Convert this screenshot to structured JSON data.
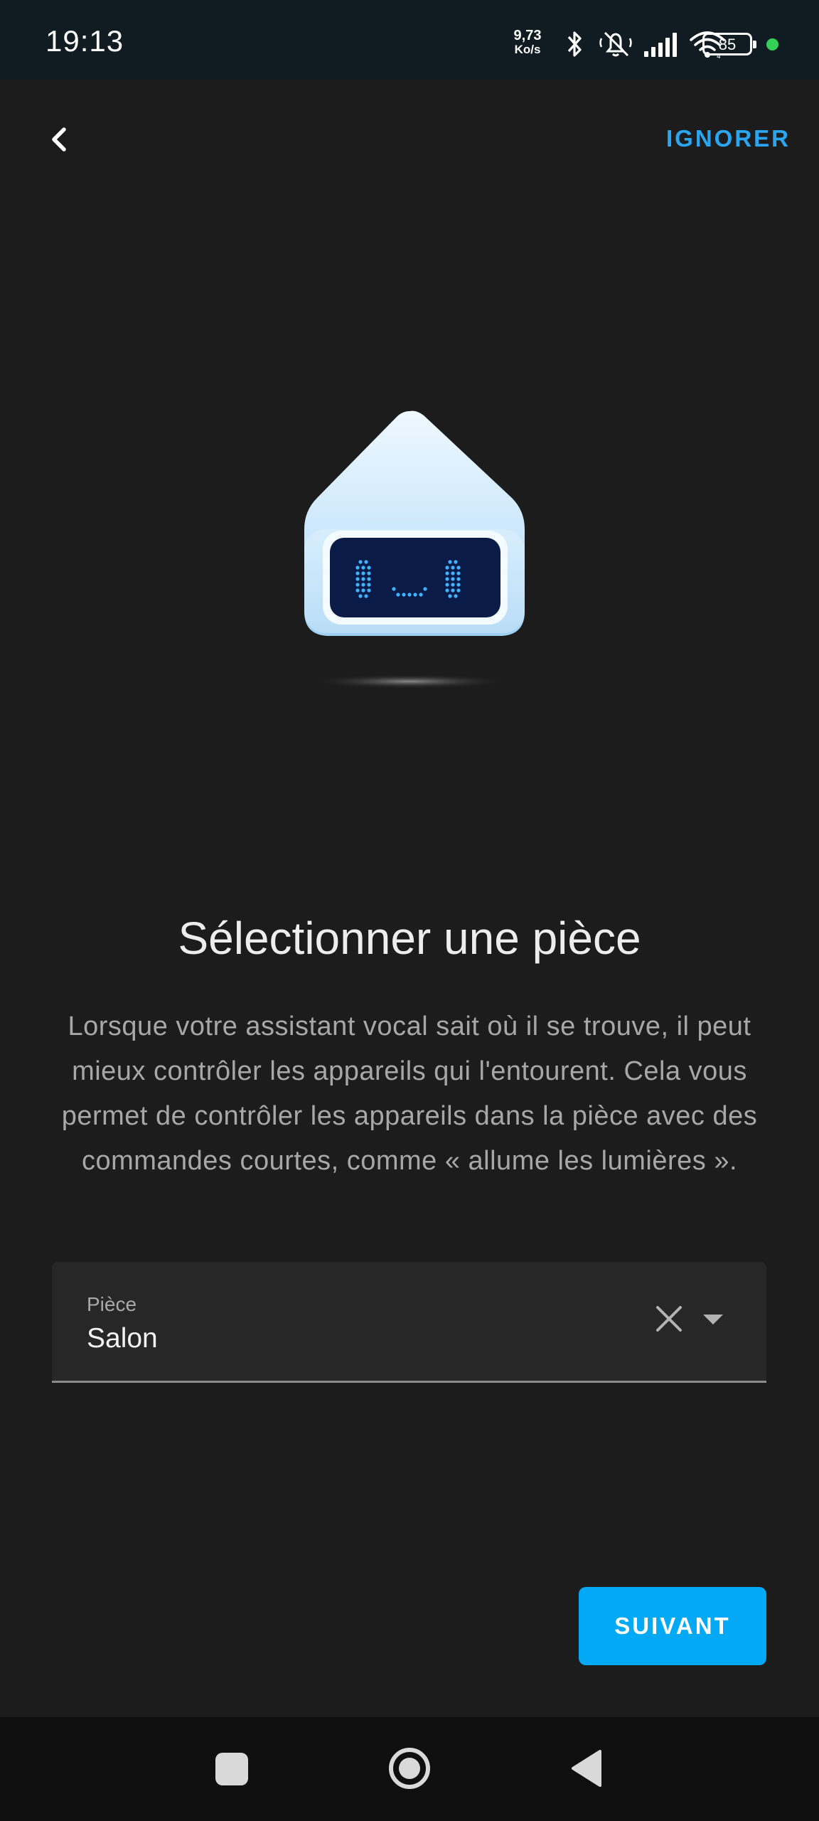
{
  "status_bar": {
    "time": "19:13",
    "net_speed_value": "9,73",
    "net_speed_unit": "Ko/s",
    "battery_level": "85",
    "icons": [
      "bluetooth-icon",
      "muted-bell-icon",
      "signal-icon",
      "wifi-icon",
      "battery-icon",
      "privacy-dot-icon"
    ]
  },
  "header": {
    "back_icon": "chevron-left-icon",
    "skip_label": "IGNORER"
  },
  "illustration": {
    "name": "voice-assistant-robot-illustration"
  },
  "content": {
    "title": "Sélectionner une pièce",
    "description": "Lorsque votre assistant vocal sait où il se trouve, il peut mieux contrôler les appareils qui l'entourent. Cela vous permet de contrôler les appareils dans la pièce avec des commandes courtes, comme « allume les lumières »."
  },
  "room_select": {
    "label": "Pièce",
    "value": "Salon",
    "clear_icon": "close-icon",
    "dropdown_icon": "caret-down-icon"
  },
  "footer": {
    "next_label": "SUIVANT"
  },
  "colors": {
    "accent": "#03a9f4",
    "skip_text": "#2aa6f1",
    "background": "#1c1c1c"
  },
  "nav_bar": {
    "icons": [
      "recents-square-icon",
      "home-circle-icon",
      "back-triangle-icon"
    ]
  }
}
